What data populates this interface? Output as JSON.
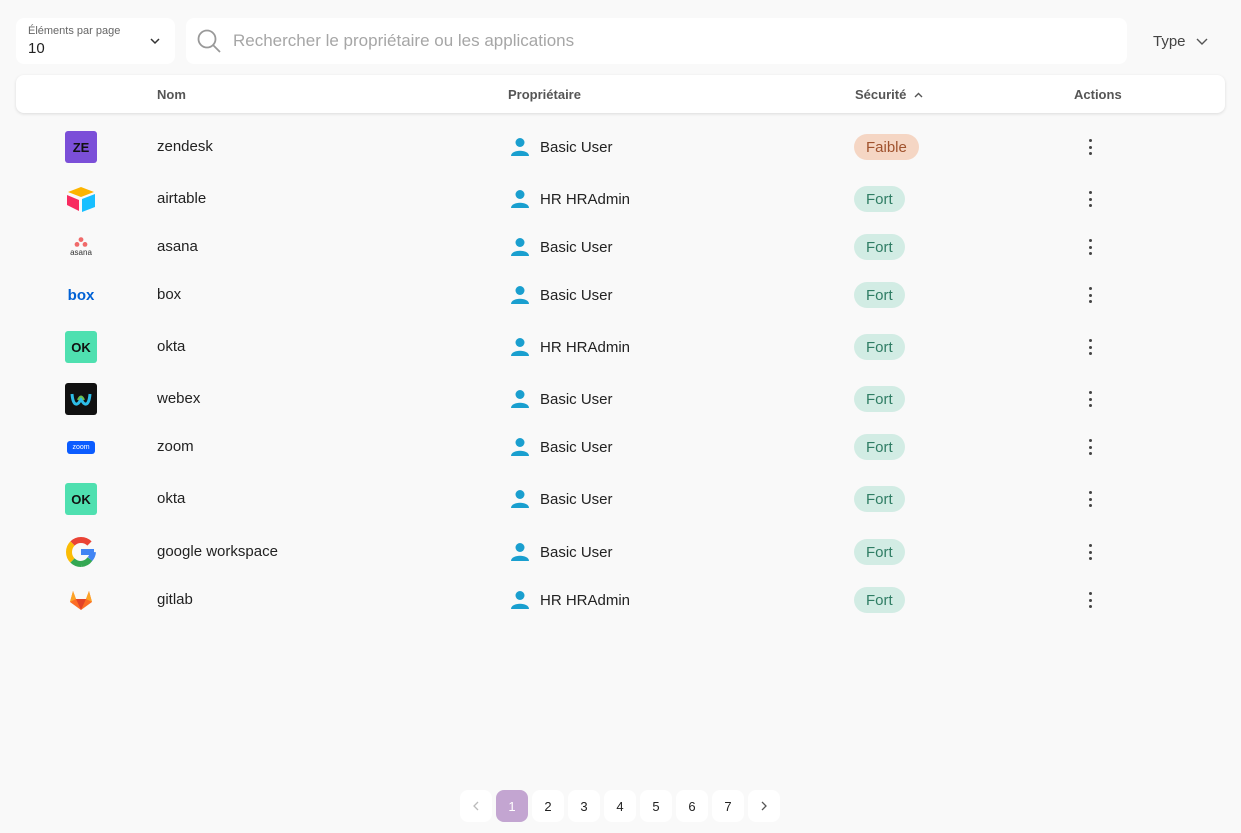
{
  "toolbar": {
    "per_page_label": "Éléments par page",
    "per_page_value": "10",
    "search_placeholder": "Rechercher le propriétaire ou les applications",
    "type_label": "Type"
  },
  "columns": {
    "name": "Nom",
    "owner": "Propriétaire",
    "security": "Sécurité",
    "actions": "Actions"
  },
  "rows": [
    {
      "app": "zendesk",
      "logo_text": "ZE",
      "owner": "Basic User",
      "security": "Faible"
    },
    {
      "app": "airtable",
      "logo_text": "",
      "owner": "HR HRAdmin",
      "security": "Fort"
    },
    {
      "app": "asana",
      "logo_text": "asana",
      "owner": "Basic User",
      "security": "Fort"
    },
    {
      "app": "box",
      "logo_text": "box",
      "owner": "Basic User",
      "security": "Fort"
    },
    {
      "app": "okta",
      "logo_text": "OK",
      "owner": "HR HRAdmin",
      "security": "Fort"
    },
    {
      "app": "webex",
      "logo_text": "",
      "owner": "Basic User",
      "security": "Fort"
    },
    {
      "app": "zoom",
      "logo_text": "zoom",
      "owner": "Basic User",
      "security": "Fort"
    },
    {
      "app": "okta",
      "logo_text": "OK",
      "owner": "Basic User",
      "security": "Fort"
    },
    {
      "app": "google workspace",
      "logo_text": "",
      "owner": "Basic User",
      "security": "Fort"
    },
    {
      "app": "gitlab",
      "logo_text": "",
      "owner": "HR HRAdmin",
      "security": "Fort"
    }
  ],
  "pagination": {
    "pages": [
      "1",
      "2",
      "3",
      "4",
      "5",
      "6",
      "7"
    ],
    "current": "1",
    "prev_icon": "chevron-left-icon",
    "next_icon": "chevron-right-icon"
  },
  "colors": {
    "owner_icon": "#1a9fcf",
    "fort_bg": "#d2ece4",
    "faible_bg": "#f5d6c4",
    "page_active": "#c3a5d1"
  }
}
